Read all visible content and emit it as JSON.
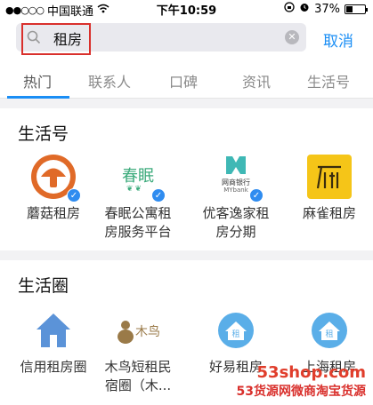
{
  "status_bar": {
    "carrier": "中国联通",
    "time": "下午10:59",
    "battery": "37%",
    "battery_level": 0.37
  },
  "search": {
    "query": "租房",
    "cancel_label": "取消"
  },
  "tabs": [
    "热门",
    "联系人",
    "口碑",
    "资讯",
    "生活号"
  ],
  "sections": {
    "life_accounts": {
      "title": "生活号",
      "items": [
        {
          "line1": "蘑菇租房",
          "line2": ""
        },
        {
          "line1": "春眠公寓租",
          "line2": "房服务平台",
          "icon_text": "春眠"
        },
        {
          "line1": "优客逸家租",
          "line2": "房分期",
          "icon_text": "网商银行",
          "icon_sub": "MYbank"
        },
        {
          "line1": "麻雀租房",
          "line2": ""
        }
      ]
    },
    "life_circles": {
      "title": "生活圈",
      "items": [
        {
          "line1": "信用租房圈",
          "line2": ""
        },
        {
          "line1": "木鸟短租民",
          "line2": "宿圈（木...",
          "icon_text": "木鸟"
        },
        {
          "line1": "好易租房",
          "line2": "",
          "icon_text": "租"
        },
        {
          "line1": "上海租房",
          "line2": "",
          "icon_text": "租"
        }
      ]
    }
  },
  "watermark": {
    "line1": "53shop.com",
    "line2": "53货源网微商淘宝货源"
  },
  "colors": {
    "accent": "#1a8ef5",
    "highlight": "#d9302c",
    "verified": "#2f8cf0"
  }
}
